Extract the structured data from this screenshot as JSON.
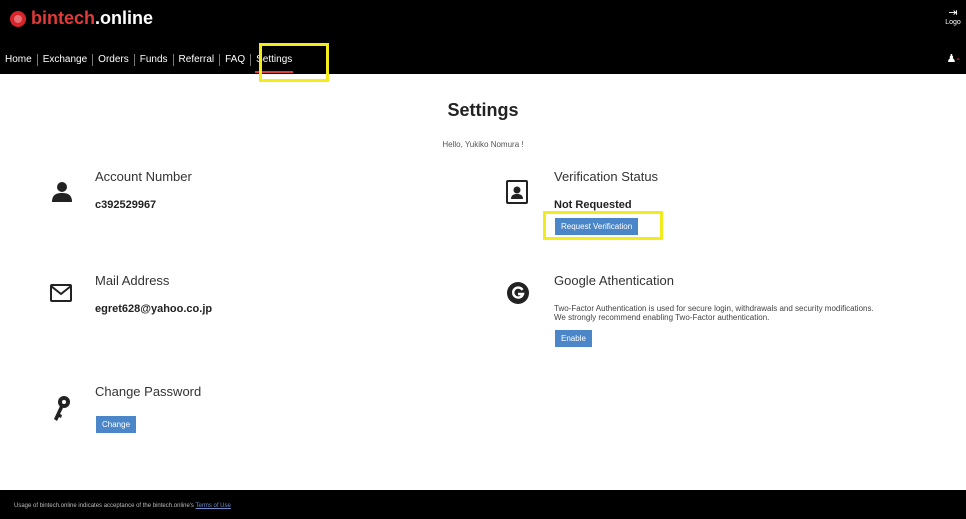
{
  "header": {
    "logo_part1": "bintech",
    "logo_part2": ".online",
    "logout_label": "Logo",
    "nav": [
      "Home",
      "Exchange",
      "Orders",
      "Funds",
      "Referral",
      "FAQ",
      "Settings"
    ],
    "active_nav": "Settings"
  },
  "page": {
    "title": "Settings",
    "greeting": "Hello, Yukiko Nomura !"
  },
  "account": {
    "title": "Account Number",
    "value": "c392529967"
  },
  "mail": {
    "title": "Mail Address",
    "value": "egret628@yahoo.co.jp"
  },
  "password": {
    "title": "Change Password",
    "button": "Change"
  },
  "verification": {
    "title": "Verification Status",
    "status": "Not Requested",
    "button": "Request Verification"
  },
  "google_auth": {
    "title": "Google Athentication",
    "description_line1": "Two-Factor Authentication is used for secure login, withdrawals and security modifications.",
    "description_line2": "We strongly recommend enabling Two-Factor authentication.",
    "button": "Enable"
  },
  "footer": {
    "text": "Usage of bintech.online indicates acceptance of the bintech.online's",
    "link": "Terms of Use"
  },
  "colors": {
    "header_bg": "#000000",
    "brand_red": "#e23a3a",
    "button_blue": "#4a86c8",
    "highlight_yellow": "#f3ec1c"
  },
  "icons": {
    "account": "person-icon",
    "mail": "envelope-icon",
    "password": "key-icon",
    "verification": "id-card-icon",
    "google": "google-icon",
    "logout": "logout-icon"
  }
}
